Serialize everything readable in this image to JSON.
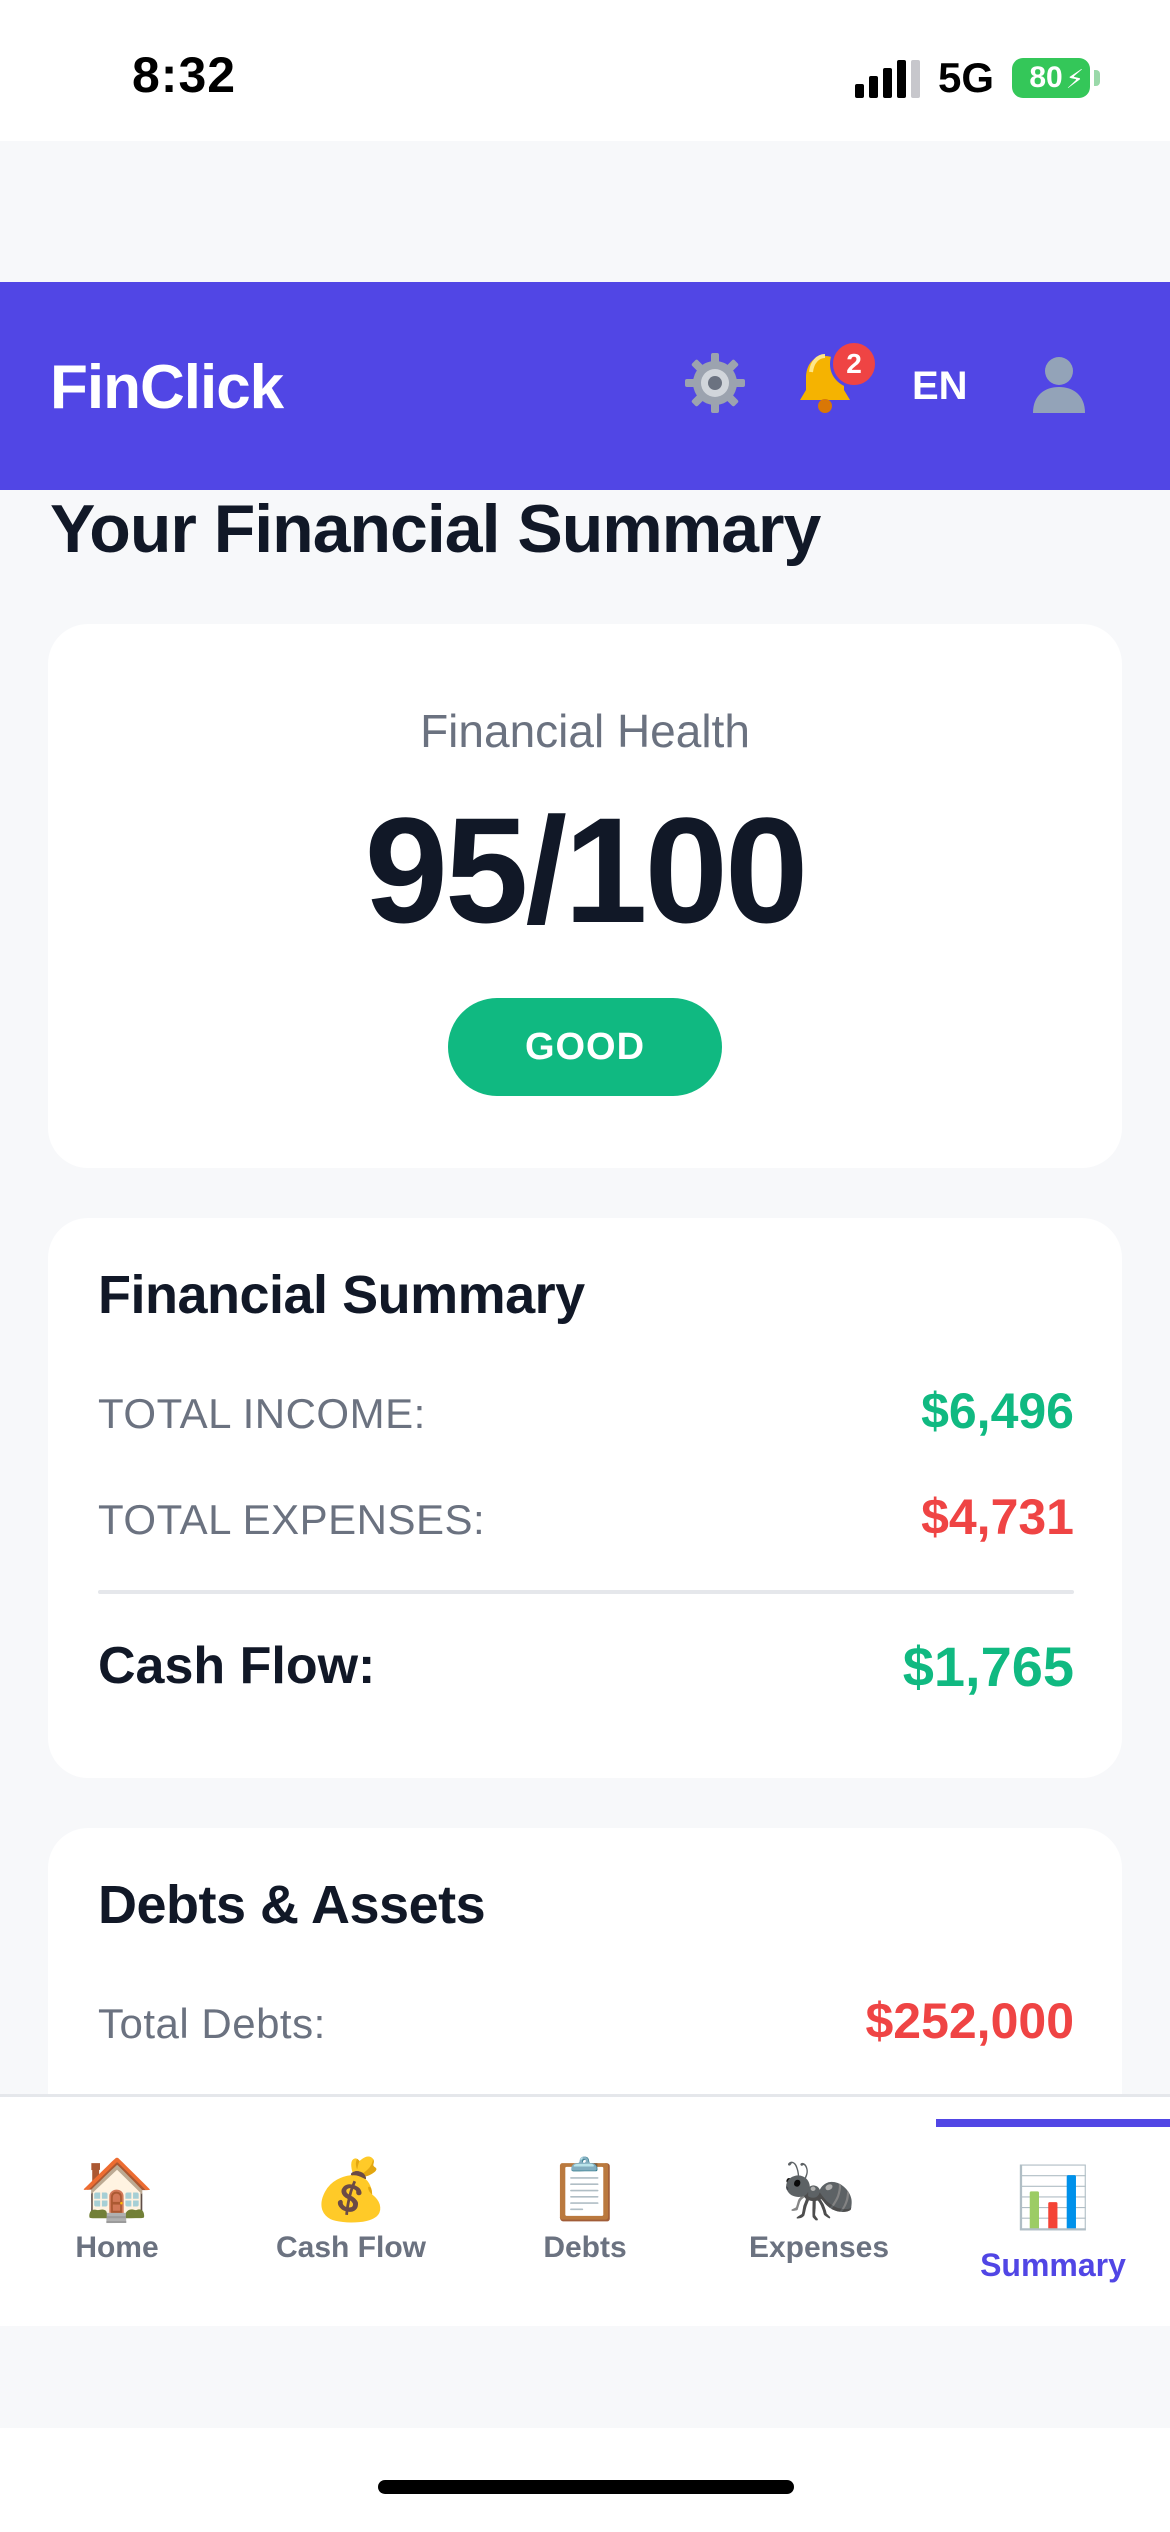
{
  "status_bar": {
    "time": "8:32",
    "network": "5G",
    "battery": "80"
  },
  "header": {
    "brand": "FinClick",
    "notification_count": "2",
    "language": "EN"
  },
  "page_title": "Your Financial Summary",
  "health": {
    "label": "Financial Health",
    "score": "95/100",
    "status": "GOOD"
  },
  "summary": {
    "title": "Financial Summary",
    "income_label": "TOTAL INCOME:",
    "income_value": "$6,496",
    "expenses_label": "TOTAL EXPENSES:",
    "expenses_value": "$4,731",
    "cashflow_label": "Cash Flow:",
    "cashflow_value": "$1,765"
  },
  "debts_assets": {
    "title": "Debts & Assets",
    "total_debts_label": "Total Debts:",
    "total_debts_value": "$252,000"
  },
  "nav": {
    "tabs": [
      {
        "label": "Home",
        "icon": "🏠",
        "icon_name": "house-icon"
      },
      {
        "label": "Cash Flow",
        "icon": "💰",
        "icon_name": "money-bag-icon"
      },
      {
        "label": "Debts",
        "icon": "📋",
        "icon_name": "clipboard-icon"
      },
      {
        "label": "Expenses",
        "icon": "🐜",
        "icon_name": "ant-icon"
      },
      {
        "label": "Summary",
        "icon": "📊",
        "icon_name": "bar-chart-icon"
      }
    ],
    "active": "Summary"
  },
  "colors": {
    "primary": "#5146e5",
    "positive": "#10b981",
    "negative": "#ef4444",
    "background": "#f7f8fa"
  }
}
